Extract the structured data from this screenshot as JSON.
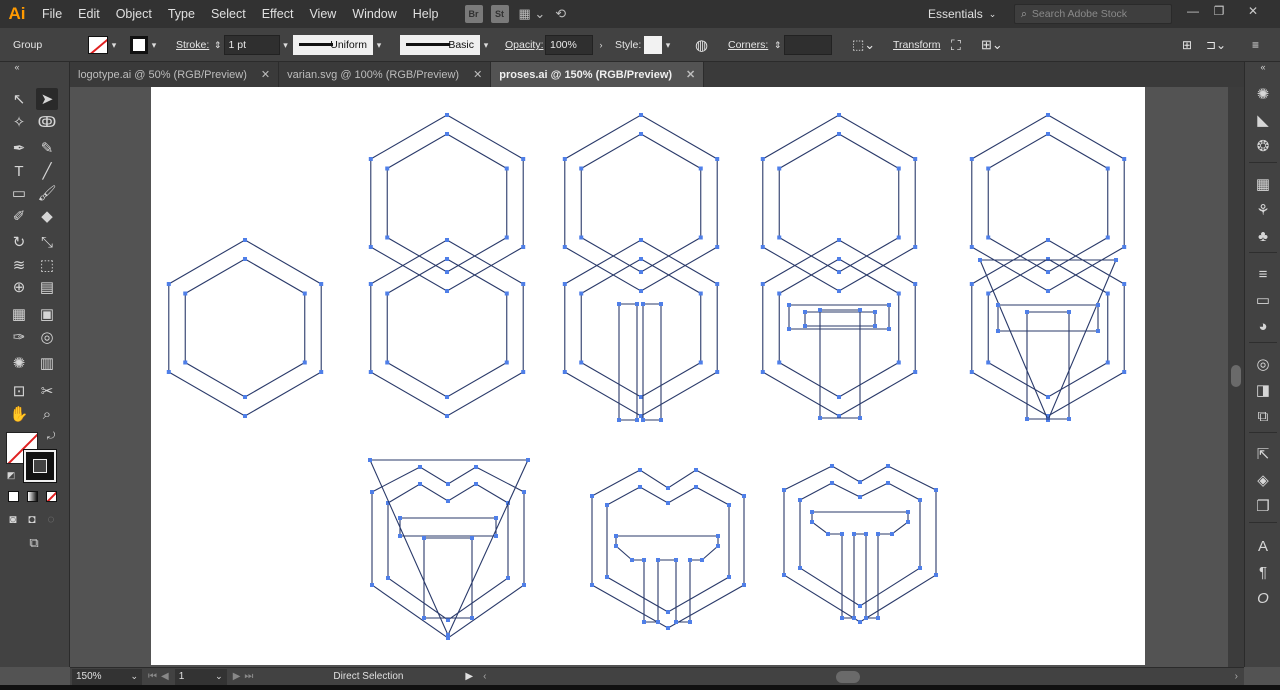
{
  "app": {
    "logo": "Ai",
    "workspace": "Essentials",
    "search_placeholder": "Search Adobe Stock"
  },
  "menu": [
    "File",
    "Edit",
    "Object",
    "Type",
    "Select",
    "Effect",
    "View",
    "Window",
    "Help"
  ],
  "menubar_icons": {
    "bridge": "Br",
    "stock": "St",
    "arrange_icon": "arrange-documents-icon",
    "gpu_icon": "gpu-performance-icon"
  },
  "control": {
    "selection_type": "Group",
    "stroke_label": "Stroke:",
    "stroke_weight": "1 pt",
    "variable_width": "Uniform",
    "brush": "Basic",
    "opacity_label": "Opacity:",
    "opacity": "100%",
    "style_label": "Style:",
    "corners_label": "Corners:",
    "transform_label": "Transform"
  },
  "tabs": [
    {
      "label": "logotype.ai @ 50% (RGB/Preview)",
      "active": false
    },
    {
      "label": "varian.svg @ 100% (RGB/Preview)",
      "active": false
    },
    {
      "label": "proses.ai @ 150% (RGB/Preview)",
      "active": true
    }
  ],
  "status": {
    "zoom": "150%",
    "artboard": "1",
    "tool": "Direct Selection"
  },
  "colors": {
    "path": "#4f7fe8",
    "stroke": "#2a3a6a",
    "accent": "#ff9a00"
  }
}
